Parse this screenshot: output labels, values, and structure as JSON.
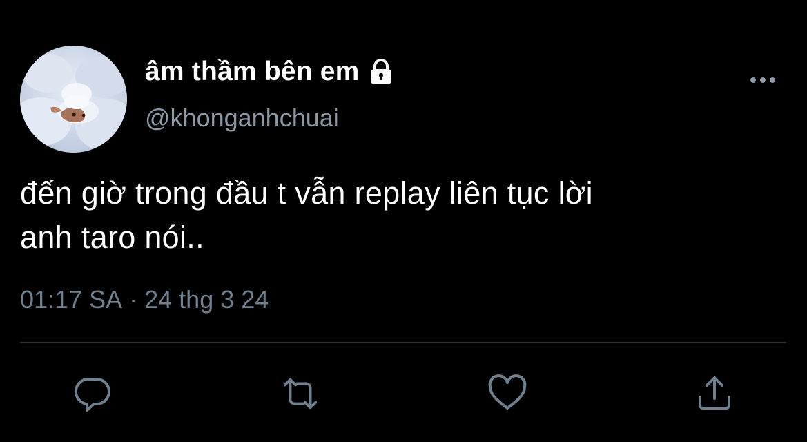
{
  "tweet": {
    "author": {
      "display_name": "âm thầm bên em",
      "handle": "@khonganhchuai",
      "protected_icon": "lock-icon",
      "avatar": "avatar-image"
    },
    "menu_icon": "more-icon",
    "text_lines": [
      "đến giờ trong đầu t vẫn replay liên tục lời",
      "anh taro nói.."
    ],
    "time": "01:17 SA",
    "separator": "·",
    "date": "24 thg 3 24",
    "actions": [
      {
        "icon": "reply-icon"
      },
      {
        "icon": "retweet-icon"
      },
      {
        "icon": "like-icon"
      },
      {
        "icon": "share-icon"
      }
    ]
  },
  "colors": {
    "background": "#000000",
    "text_primary": "#ffffff",
    "text_secondary": "#8b98a5",
    "meta": "#71808f",
    "divider": "#2f3336",
    "icon": "#71808f"
  }
}
